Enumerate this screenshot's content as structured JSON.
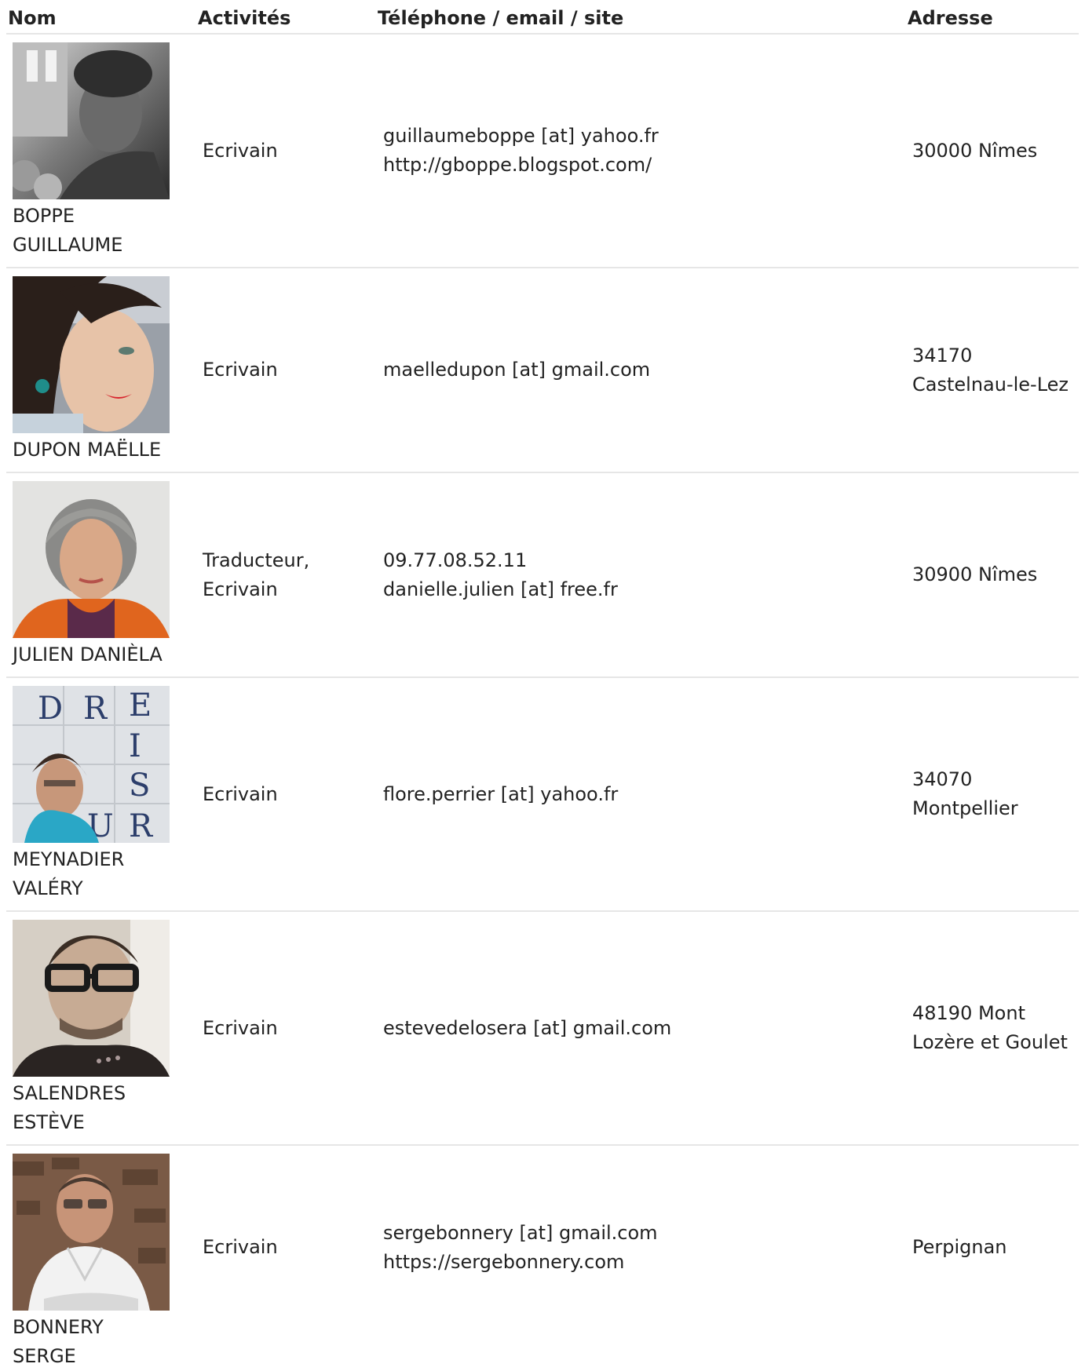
{
  "columns": {
    "nom": "Nom",
    "activites": "Activités",
    "contact": "Téléphone / email / site",
    "adresse": "Adresse"
  },
  "rows": [
    {
      "name": "BOPPE GUILLAUME",
      "activity": "Ecrivain",
      "contact": [
        "guillaumeboppe [at] yahoo.fr",
        "http://gboppe.blogspot.com/"
      ],
      "address": "30000 Nîmes",
      "photo_icon": "portrait-photo"
    },
    {
      "name": "DUPON MAËLLE",
      "activity": "Ecrivain",
      "contact": [
        "maelledupon [at] gmail.com"
      ],
      "address": "34170 Castelnau-le-Lez",
      "photo_icon": "portrait-photo"
    },
    {
      "name": "JULIEN DANIÈLA",
      "activity": "Traducteur, Ecrivain",
      "contact": [
        "09.77.08.52.11",
        "danielle.julien [at] free.fr"
      ],
      "address": "30900 Nîmes",
      "photo_icon": "portrait-photo"
    },
    {
      "name": "MEYNADIER VALÉRY",
      "activity": "Ecrivain",
      "contact": [
        "flore.perrier [at] yahoo.fr"
      ],
      "address": "34070 Montpellier",
      "photo_icon": "portrait-photo"
    },
    {
      "name": "SALENDRES ESTÈVE",
      "activity": "Ecrivain",
      "contact": [
        "estevedelosera [at] gmail.com"
      ],
      "address": "48190 Mont Lozère et Goulet",
      "photo_icon": "portrait-photo"
    },
    {
      "name": "BONNERY SERGE",
      "activity": "Ecrivain",
      "contact": [
        "sergebonnery [at] gmail.com",
        "https://sergebonnery.com"
      ],
      "address": "Perpignan",
      "photo_icon": "portrait-photo"
    }
  ],
  "colors": {
    "divider": "#e6e6e6",
    "text": "#222222"
  }
}
